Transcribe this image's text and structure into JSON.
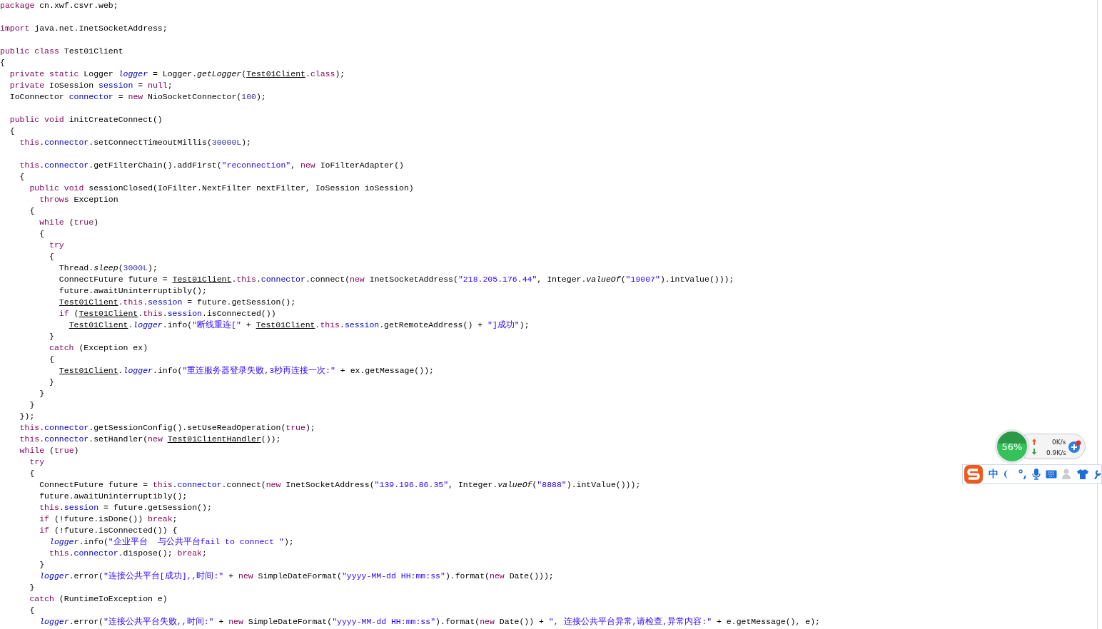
{
  "code_lines": [
    {
      "kind": "code",
      "tokens": [
        {
          "kind": "kw",
          "text": "package"
        },
        {
          "kind": "p",
          "text": " cn.xwf.csvr.web;"
        }
      ]
    },
    {
      "kind": "blank"
    },
    {
      "kind": "code",
      "tokens": [
        {
          "kind": "kw",
          "text": "import"
        },
        {
          "kind": "p",
          "text": " java.net.InetSocketAddress;"
        }
      ]
    },
    {
      "kind": "blank"
    },
    {
      "kind": "code",
      "tokens": [
        {
          "kind": "kw",
          "text": "public class"
        },
        {
          "kind": "p",
          "text": " Test01Client"
        }
      ]
    },
    {
      "kind": "code",
      "tokens": [
        {
          "kind": "p",
          "text": "{"
        }
      ]
    },
    {
      "kind": "code",
      "tokens": [
        {
          "kind": "kw",
          "text": "  private static"
        },
        {
          "kind": "p",
          "text": " Logger "
        },
        {
          "kind": "sfld",
          "text": "logger"
        },
        {
          "kind": "p",
          "text": " = Logger."
        },
        {
          "kind": "im",
          "text": "getLogger"
        },
        {
          "kind": "p",
          "text": "("
        },
        {
          "kind": "cls",
          "text": "Test01Client"
        },
        {
          "kind": "p",
          "text": "."
        },
        {
          "kind": "kw",
          "text": "class"
        },
        {
          "kind": "p",
          "text": ");"
        }
      ]
    },
    {
      "kind": "code",
      "tokens": [
        {
          "kind": "kw",
          "text": "  private"
        },
        {
          "kind": "p",
          "text": " IoSession "
        },
        {
          "kind": "fld",
          "text": "session"
        },
        {
          "kind": "p",
          "text": " = "
        },
        {
          "kind": "kw",
          "text": "null"
        },
        {
          "kind": "p",
          "text": ";"
        }
      ]
    },
    {
      "kind": "code",
      "tokens": [
        {
          "kind": "p",
          "text": "  IoConnector "
        },
        {
          "kind": "fld",
          "text": "connector"
        },
        {
          "kind": "p",
          "text": " = "
        },
        {
          "kind": "kw",
          "text": "new"
        },
        {
          "kind": "p",
          "text": " NioSocketConnector("
        },
        {
          "kind": "num",
          "text": "100"
        },
        {
          "kind": "p",
          "text": ");"
        }
      ]
    },
    {
      "kind": "blank"
    },
    {
      "kind": "code",
      "tokens": [
        {
          "kind": "kw",
          "text": "  public void"
        },
        {
          "kind": "p",
          "text": " initCreateConnect()"
        }
      ]
    },
    {
      "kind": "code",
      "tokens": [
        {
          "kind": "p",
          "text": "  {"
        }
      ]
    },
    {
      "kind": "code",
      "tokens": [
        {
          "kind": "kw",
          "text": "    this"
        },
        {
          "kind": "p",
          "text": "."
        },
        {
          "kind": "fld",
          "text": "connector"
        },
        {
          "kind": "p",
          "text": ".setConnectTimeoutMillis("
        },
        {
          "kind": "num",
          "text": "30000L"
        },
        {
          "kind": "p",
          "text": ");"
        }
      ]
    },
    {
      "kind": "blank"
    },
    {
      "kind": "code",
      "tokens": [
        {
          "kind": "kw",
          "text": "    this"
        },
        {
          "kind": "p",
          "text": "."
        },
        {
          "kind": "fld",
          "text": "connector"
        },
        {
          "kind": "p",
          "text": ".getFilterChain().addFirst("
        },
        {
          "kind": "str",
          "text": "\"reconnection\""
        },
        {
          "kind": "p",
          "text": ", "
        },
        {
          "kind": "kw",
          "text": "new"
        },
        {
          "kind": "p",
          "text": " IoFilterAdapter()"
        }
      ]
    },
    {
      "kind": "code",
      "tokens": [
        {
          "kind": "p",
          "text": "    {"
        }
      ]
    },
    {
      "kind": "code",
      "tokens": [
        {
          "kind": "kw",
          "text": "      public void"
        },
        {
          "kind": "p",
          "text": " sessionClosed(IoFilter.NextFilter nextFilter, IoSession ioSession)"
        }
      ]
    },
    {
      "kind": "code",
      "tokens": [
        {
          "kind": "kw",
          "text": "        throws"
        },
        {
          "kind": "p",
          "text": " Exception"
        }
      ]
    },
    {
      "kind": "code",
      "tokens": [
        {
          "kind": "p",
          "text": "      {"
        }
      ]
    },
    {
      "kind": "code",
      "tokens": [
        {
          "kind": "kw",
          "text": "        while"
        },
        {
          "kind": "p",
          "text": " ("
        },
        {
          "kind": "kw",
          "text": "true"
        },
        {
          "kind": "p",
          "text": ")"
        }
      ]
    },
    {
      "kind": "code",
      "tokens": [
        {
          "kind": "p",
          "text": "        {"
        }
      ]
    },
    {
      "kind": "code",
      "tokens": [
        {
          "kind": "kw",
          "text": "          try"
        }
      ]
    },
    {
      "kind": "code",
      "tokens": [
        {
          "kind": "p",
          "text": "          {"
        }
      ]
    },
    {
      "kind": "code",
      "tokens": [
        {
          "kind": "p",
          "text": "            Thread."
        },
        {
          "kind": "im",
          "text": "sleep"
        },
        {
          "kind": "p",
          "text": "("
        },
        {
          "kind": "num",
          "text": "3000L"
        },
        {
          "kind": "p",
          "text": ");"
        }
      ]
    },
    {
      "kind": "code",
      "tokens": [
        {
          "kind": "p",
          "text": "            ConnectFuture future = "
        },
        {
          "kind": "cls",
          "text": "Test01Client"
        },
        {
          "kind": "p",
          "text": "."
        },
        {
          "kind": "kw",
          "text": "this"
        },
        {
          "kind": "p",
          "text": "."
        },
        {
          "kind": "fld",
          "text": "connector"
        },
        {
          "kind": "p",
          "text": ".connect("
        },
        {
          "kind": "kw",
          "text": "new"
        },
        {
          "kind": "p",
          "text": " InetSocketAddress("
        },
        {
          "kind": "str",
          "text": "\"218.205.176.44\""
        },
        {
          "kind": "p",
          "text": ", Integer."
        },
        {
          "kind": "im",
          "text": "valueOf"
        },
        {
          "kind": "p",
          "text": "("
        },
        {
          "kind": "str",
          "text": "\"19007\""
        },
        {
          "kind": "p",
          "text": ").intValue()));"
        }
      ]
    },
    {
      "kind": "code",
      "tokens": [
        {
          "kind": "p",
          "text": "            future.awaitUninterruptibly();"
        }
      ]
    },
    {
      "kind": "code",
      "tokens": [
        {
          "kind": "cls",
          "text": "            Test01Client"
        },
        {
          "kind": "p",
          "text": "."
        },
        {
          "kind": "kw",
          "text": "this"
        },
        {
          "kind": "p",
          "text": "."
        },
        {
          "kind": "fld",
          "text": "session"
        },
        {
          "kind": "p",
          "text": " = future.getSession();"
        }
      ]
    },
    {
      "kind": "code",
      "tokens": [
        {
          "kind": "kw",
          "text": "            if"
        },
        {
          "kind": "p",
          "text": " ("
        },
        {
          "kind": "cls",
          "text": "Test01Client"
        },
        {
          "kind": "p",
          "text": "."
        },
        {
          "kind": "kw",
          "text": "this"
        },
        {
          "kind": "p",
          "text": "."
        },
        {
          "kind": "fld",
          "text": "session"
        },
        {
          "kind": "p",
          "text": ".isConnected())"
        }
      ]
    },
    {
      "kind": "code",
      "tokens": [
        {
          "kind": "cls",
          "text": "              Test01Client"
        },
        {
          "kind": "p",
          "text": "."
        },
        {
          "kind": "sfld",
          "text": "logger"
        },
        {
          "kind": "p",
          "text": ".info("
        },
        {
          "kind": "str",
          "text": "\"断线重连[\""
        },
        {
          "kind": "p",
          "text": " + "
        },
        {
          "kind": "cls",
          "text": "Test01Client"
        },
        {
          "kind": "p",
          "text": "."
        },
        {
          "kind": "kw",
          "text": "this"
        },
        {
          "kind": "p",
          "text": "."
        },
        {
          "kind": "fld",
          "text": "session"
        },
        {
          "kind": "p",
          "text": ".getRemoteAddress() + "
        },
        {
          "kind": "str",
          "text": "\"]成功\""
        },
        {
          "kind": "p",
          "text": ");"
        }
      ]
    },
    {
      "kind": "code",
      "tokens": [
        {
          "kind": "p",
          "text": "          }"
        }
      ]
    },
    {
      "kind": "code",
      "tokens": [
        {
          "kind": "kw",
          "text": "          catch"
        },
        {
          "kind": "p",
          "text": " (Exception ex)"
        }
      ]
    },
    {
      "kind": "code",
      "tokens": [
        {
          "kind": "p",
          "text": "          {"
        }
      ]
    },
    {
      "kind": "code",
      "tokens": [
        {
          "kind": "cls",
          "text": "            Test01Client"
        },
        {
          "kind": "p",
          "text": "."
        },
        {
          "kind": "sfld",
          "text": "logger"
        },
        {
          "kind": "p",
          "text": ".info("
        },
        {
          "kind": "str",
          "text": "\"重连服务器登录失败,3秒再连接一次:\""
        },
        {
          "kind": "p",
          "text": " + ex.getMessage());"
        }
      ]
    },
    {
      "kind": "code",
      "tokens": [
        {
          "kind": "p",
          "text": "          }"
        }
      ]
    },
    {
      "kind": "code",
      "tokens": [
        {
          "kind": "p",
          "text": "        }"
        }
      ]
    },
    {
      "kind": "code",
      "tokens": [
        {
          "kind": "p",
          "text": "      }"
        }
      ]
    },
    {
      "kind": "code",
      "tokens": [
        {
          "kind": "p",
          "text": "    });"
        }
      ]
    },
    {
      "kind": "code",
      "tokens": [
        {
          "kind": "kw",
          "text": "    this"
        },
        {
          "kind": "p",
          "text": "."
        },
        {
          "kind": "fld",
          "text": "connector"
        },
        {
          "kind": "p",
          "text": ".getSessionConfig().setUseReadOperation("
        },
        {
          "kind": "kw",
          "text": "true"
        },
        {
          "kind": "p",
          "text": ");"
        }
      ]
    },
    {
      "kind": "code",
      "tokens": [
        {
          "kind": "kw",
          "text": "    this"
        },
        {
          "kind": "p",
          "text": "."
        },
        {
          "kind": "fld",
          "text": "connector"
        },
        {
          "kind": "p",
          "text": ".setHandler("
        },
        {
          "kind": "kw",
          "text": "new "
        },
        {
          "kind": "cls",
          "text": "Test01ClientHandler"
        },
        {
          "kind": "p",
          "text": "());"
        }
      ]
    },
    {
      "kind": "code",
      "tokens": [
        {
          "kind": "kw",
          "text": "    while"
        },
        {
          "kind": "p",
          "text": " ("
        },
        {
          "kind": "kw",
          "text": "true"
        },
        {
          "kind": "p",
          "text": ")"
        }
      ]
    },
    {
      "kind": "code",
      "tokens": [
        {
          "kind": "kw",
          "text": "      try"
        }
      ]
    },
    {
      "kind": "code",
      "tokens": [
        {
          "kind": "p",
          "text": "      {"
        }
      ]
    },
    {
      "kind": "code",
      "tokens": [
        {
          "kind": "p",
          "text": "        ConnectFuture future = "
        },
        {
          "kind": "kw",
          "text": "this"
        },
        {
          "kind": "p",
          "text": "."
        },
        {
          "kind": "fld",
          "text": "connector"
        },
        {
          "kind": "p",
          "text": ".connect("
        },
        {
          "kind": "kw",
          "text": "new"
        },
        {
          "kind": "p",
          "text": " InetSocketAddress("
        },
        {
          "kind": "str",
          "text": "\"139.196.86.35\""
        },
        {
          "kind": "p",
          "text": ", Integer."
        },
        {
          "kind": "im",
          "text": "valueOf"
        },
        {
          "kind": "p",
          "text": "("
        },
        {
          "kind": "str",
          "text": "\"8888\""
        },
        {
          "kind": "p",
          "text": ").intValue()));"
        }
      ]
    },
    {
      "kind": "code",
      "tokens": [
        {
          "kind": "p",
          "text": "        future.awaitUninterruptibly();"
        }
      ]
    },
    {
      "kind": "code",
      "tokens": [
        {
          "kind": "kw",
          "text": "        this"
        },
        {
          "kind": "p",
          "text": "."
        },
        {
          "kind": "fld",
          "text": "session"
        },
        {
          "kind": "p",
          "text": " = future.getSession();"
        }
      ]
    },
    {
      "kind": "code",
      "tokens": [
        {
          "kind": "kw",
          "text": "        if"
        },
        {
          "kind": "p",
          "text": " (!future.isDone()) "
        },
        {
          "kind": "kw",
          "text": "break"
        },
        {
          "kind": "p",
          "text": ";"
        }
      ]
    },
    {
      "kind": "code",
      "tokens": [
        {
          "kind": "kw",
          "text": "        if"
        },
        {
          "kind": "p",
          "text": " (!future.isConnected()) {"
        }
      ]
    },
    {
      "kind": "code",
      "tokens": [
        {
          "kind": "sfld",
          "text": "          logger"
        },
        {
          "kind": "p",
          "text": ".info("
        },
        {
          "kind": "str",
          "text": "\"企业平台  与公共平台fail to connect \""
        },
        {
          "kind": "p",
          "text": ");"
        }
      ]
    },
    {
      "kind": "code",
      "tokens": [
        {
          "kind": "kw",
          "text": "          this"
        },
        {
          "kind": "p",
          "text": "."
        },
        {
          "kind": "fld",
          "text": "connector"
        },
        {
          "kind": "p",
          "text": ".dispose(); "
        },
        {
          "kind": "kw",
          "text": "break"
        },
        {
          "kind": "p",
          "text": ";"
        }
      ]
    },
    {
      "kind": "code",
      "tokens": [
        {
          "kind": "p",
          "text": "        }"
        }
      ]
    },
    {
      "kind": "code",
      "tokens": [
        {
          "kind": "sfld",
          "text": "        logger"
        },
        {
          "kind": "p",
          "text": ".error("
        },
        {
          "kind": "str",
          "text": "\"连接公共平台[成功],,时间:\""
        },
        {
          "kind": "p",
          "text": " + "
        },
        {
          "kind": "kw",
          "text": "new"
        },
        {
          "kind": "p",
          "text": " SimpleDateFormat("
        },
        {
          "kind": "str",
          "text": "\"yyyy-MM-dd HH:mm:ss\""
        },
        {
          "kind": "p",
          "text": ").format("
        },
        {
          "kind": "kw",
          "text": "new"
        },
        {
          "kind": "p",
          "text": " Date()));"
        }
      ]
    },
    {
      "kind": "code",
      "tokens": [
        {
          "kind": "p",
          "text": "      }"
        }
      ]
    },
    {
      "kind": "code",
      "tokens": [
        {
          "kind": "kw",
          "text": "      catch"
        },
        {
          "kind": "p",
          "text": " (RuntimeIoException e)"
        }
      ]
    },
    {
      "kind": "code",
      "tokens": [
        {
          "kind": "p",
          "text": "      {"
        }
      ]
    },
    {
      "kind": "code",
      "tokens": [
        {
          "kind": "sfld",
          "text": "        logger"
        },
        {
          "kind": "p",
          "text": ".error("
        },
        {
          "kind": "str",
          "text": "\"连接公共平台失败,,时间:\""
        },
        {
          "kind": "p",
          "text": " + "
        },
        {
          "kind": "kw",
          "text": "new"
        },
        {
          "kind": "p",
          "text": " SimpleDateFormat("
        },
        {
          "kind": "str",
          "text": "\"yyyy-MM-dd HH:mm:ss\""
        },
        {
          "kind": "p",
          "text": ").format("
        },
        {
          "kind": "kw",
          "text": "new"
        },
        {
          "kind": "p",
          "text": " Date()) + "
        },
        {
          "kind": "str",
          "text": "\", 连接公共平台异常,请检查,异常内容:\""
        },
        {
          "kind": "p",
          "text": " + e.getMessage(), e);"
        }
      ]
    }
  ],
  "net_meter": {
    "percent": "56%",
    "upload": "0K/s",
    "download": "0.9K/s"
  },
  "ime_toolbar": {
    "mode": "中"
  }
}
